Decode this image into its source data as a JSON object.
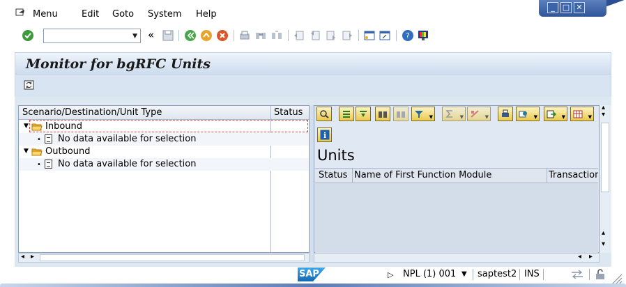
{
  "menubar": {
    "items": [
      "Menu",
      "Edit",
      "Goto",
      "System",
      "Help"
    ]
  },
  "toolbar": {
    "command_field_value": "",
    "enter_icon": "check-icon",
    "back_shortcut": "«"
  },
  "window_controls": {
    "minimize": "_",
    "maximize": "□",
    "close": "✕"
  },
  "page": {
    "title": "Monitor for bgRFC Units"
  },
  "tree": {
    "col_scenario": "Scenario/Destination/Unit Type",
    "col_status": "Status",
    "nodes": [
      {
        "label": "Inbound",
        "child": "No data available for selection"
      },
      {
        "label": "Outbound",
        "child": "No data available for selection"
      }
    ]
  },
  "units_panel": {
    "heading": "Units",
    "columns": [
      "Status",
      "Name of First Function Module",
      "Transaction"
    ]
  },
  "statusbar": {
    "logo": "SAP",
    "system": "NPL (1) 001",
    "user": "saptest2",
    "mode": "INS"
  },
  "colors": {
    "title_gradient_top": "#eef4fb",
    "title_gradient_bottom": "#cddcee",
    "button_gold": "#e9c94c",
    "accent_blue": "#2f5599"
  }
}
